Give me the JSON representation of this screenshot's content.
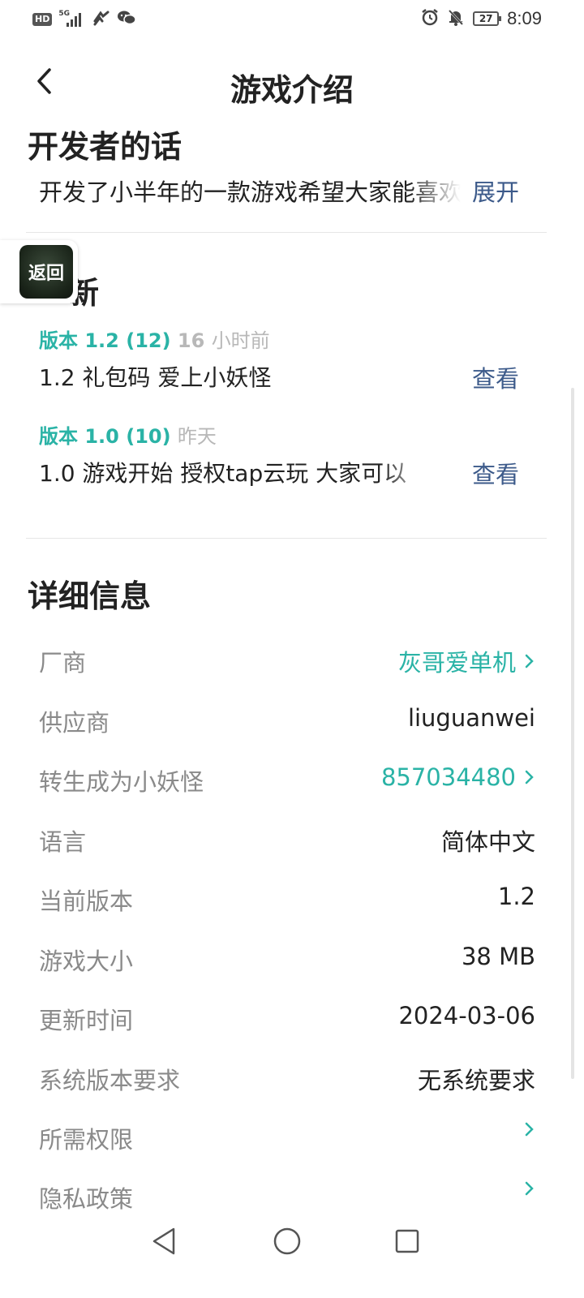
{
  "status_bar": {
    "hd_label": "HD",
    "network_label": "5G",
    "battery": "27",
    "time": "8:09"
  },
  "header": {
    "title": "游戏介绍"
  },
  "developer_note": {
    "title": "开发者的话",
    "text": "开发了小半年的一款游戏希望大家能喜欢",
    "expand_label": "展开"
  },
  "float_button": {
    "label": "返回"
  },
  "updates": {
    "title_visible_part": "新",
    "items": [
      {
        "version": "版本 1.2 (12)",
        "time_num": "16",
        "time_unit": "小时前",
        "desc": "1.2 礼包码 爱上小妖怪",
        "action": "查看"
      },
      {
        "version": "版本 1.0 (10)",
        "time_num": "",
        "time_unit": "昨天",
        "desc": "1.0 游戏开始 授权tap云玩 大家可以",
        "action": "查看"
      }
    ]
  },
  "details": {
    "title": "详细信息",
    "rows": [
      {
        "label": "厂商",
        "value": "灰哥爱单机",
        "link": true
      },
      {
        "label": "供应商",
        "value": "liuguanwei",
        "link": false
      },
      {
        "label": "转生成为小妖怪",
        "value": "857034480",
        "link": true
      },
      {
        "label": "语言",
        "value": "简体中文",
        "link": false
      },
      {
        "label": "当前版本",
        "value": "1.2",
        "link": false
      },
      {
        "label": "游戏大小",
        "value": "38 MB",
        "link": false
      },
      {
        "label": "更新时间",
        "value": "2024-03-06",
        "link": false
      },
      {
        "label": "系统版本要求",
        "value": "无系统要求",
        "link": false
      },
      {
        "label": "所需权限",
        "value": "",
        "link": true
      },
      {
        "label": "隐私政策",
        "value": "",
        "link": true
      }
    ]
  },
  "colors": {
    "accent": "#2ab3a6",
    "link_blue": "#3c5a8a",
    "label_gray": "#8a8a8a"
  },
  "icons": {
    "back": "arrow-left",
    "nav_back": "triangle-left",
    "nav_home": "circle",
    "nav_recent": "square"
  }
}
